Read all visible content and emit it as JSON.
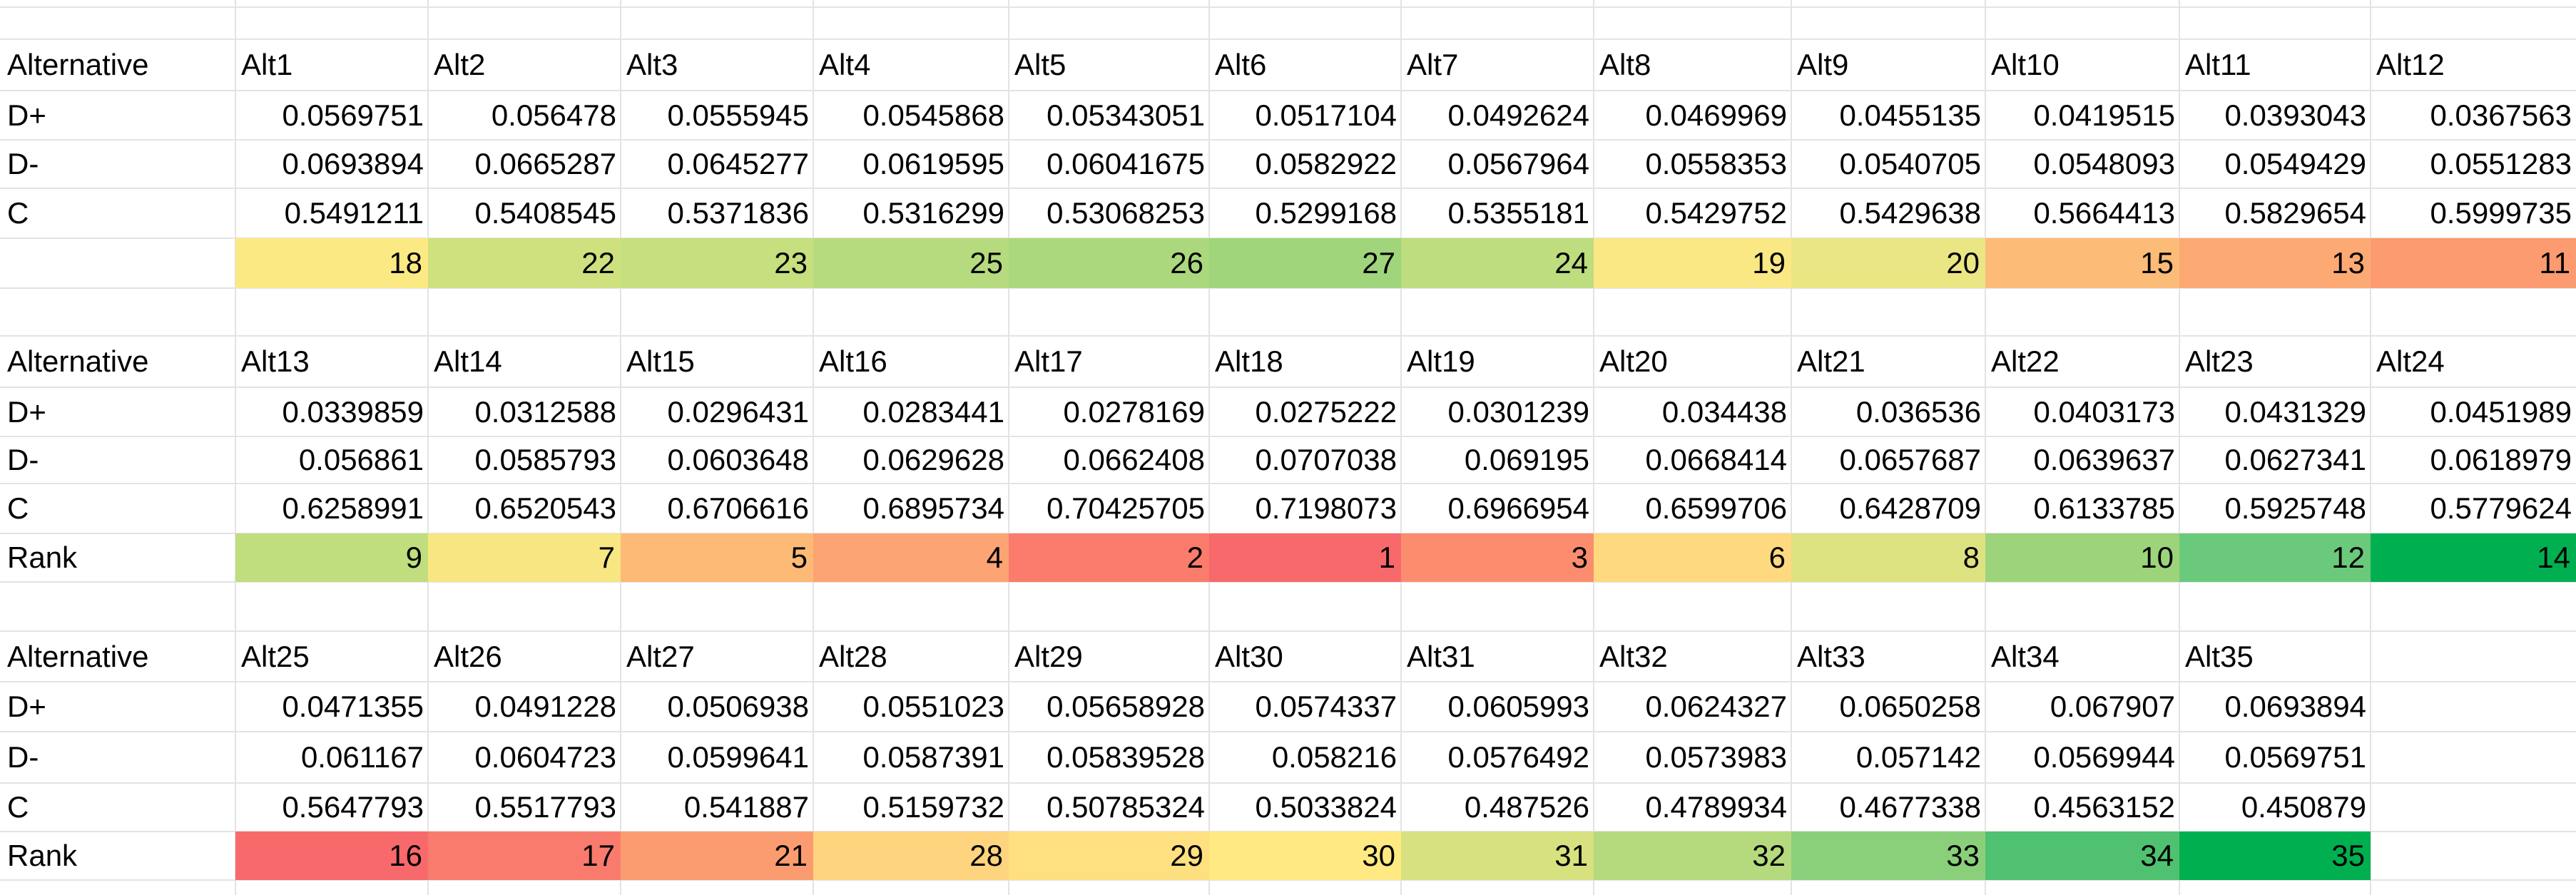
{
  "sheet": {
    "blocks": [
      {
        "header_label": "Alternative",
        "alternatives": [
          "Alt1",
          "Alt2",
          "Alt3",
          "Alt4",
          "Alt5",
          "Alt6",
          "Alt7",
          "Alt8",
          "Alt9",
          "Alt10",
          "Alt11",
          "Alt12"
        ],
        "rows": [
          {
            "label": "D+",
            "values": [
              "0.0569751",
              "0.056478",
              "0.0555945",
              "0.0545868",
              "0.05343051",
              "0.0517104",
              "0.0492624",
              "0.0469969",
              "0.0455135",
              "0.0419515",
              "0.0393043",
              "0.0367563"
            ]
          },
          {
            "label": "D-",
            "values": [
              "0.0693894",
              "0.0665287",
              "0.0645277",
              "0.0619595",
              "0.06041675",
              "0.0582922",
              "0.0567964",
              "0.0558353",
              "0.0540705",
              "0.0548093",
              "0.0549429",
              "0.0551283"
            ]
          },
          {
            "label": "C",
            "values": [
              "0.5491211",
              "0.5408545",
              "0.5371836",
              "0.5316299",
              "0.53068253",
              "0.5299168",
              "0.5355181",
              "0.5429752",
              "0.5429638",
              "0.5664413",
              "0.5829654",
              "0.5999735"
            ]
          }
        ],
        "rank_label": "",
        "ranks": [
          "18",
          "22",
          "23",
          "25",
          "26",
          "27",
          "24",
          "19",
          "20",
          "15",
          "13",
          "11"
        ],
        "rank_colors": [
          "#fbe983",
          "#cfe17f",
          "#c6df7f",
          "#b6db7e",
          "#abd87d",
          "#a0d57c",
          "#bddd7e",
          "#f9e883",
          "#eae683",
          "#fdbb78",
          "#fda974",
          "#fc9a70"
        ]
      },
      {
        "header_label": "Alternative",
        "alternatives": [
          "Alt13",
          "Alt14",
          "Alt15",
          "Alt16",
          "Alt17",
          "Alt18",
          "Alt19",
          "Alt20",
          "Alt21",
          "Alt22",
          "Alt23",
          "Alt24"
        ],
        "rows": [
          {
            "label": "D+",
            "values": [
              "0.0339859",
              "0.0312588",
              "0.0296431",
              "0.0283441",
              "0.0278169",
              "0.0275222",
              "0.0301239",
              "0.034438",
              "0.036536",
              "0.0403173",
              "0.0431329",
              "0.0451989"
            ]
          },
          {
            "label": "D-",
            "values": [
              "0.056861",
              "0.0585793",
              "0.0603648",
              "0.0629628",
              "0.0662408",
              "0.0707038",
              "0.069195",
              "0.0668414",
              "0.0657687",
              "0.0639637",
              "0.0627341",
              "0.0618979"
            ]
          },
          {
            "label": "C",
            "values": [
              "0.6258991",
              "0.6520543",
              "0.6706616",
              "0.6895734",
              "0.70425705",
              "0.7198073",
              "0.6966954",
              "0.6599706",
              "0.6428709",
              "0.6133785",
              "0.5925748",
              "0.5779624"
            ]
          }
        ],
        "rank_label": "Rank",
        "ranks": [
          "9",
          "7",
          "5",
          "4",
          "2",
          "1",
          "3",
          "6",
          "8",
          "10",
          "12",
          "14"
        ],
        "rank_colors": [
          "#c1de7f",
          "#f7e682",
          "#fdba77",
          "#fca473",
          "#fb7b6c",
          "#f8696b",
          "#fb8d6e",
          "#fed980",
          "#dde281",
          "#9dd47b",
          "#6bc97b",
          "#00b050"
        ]
      },
      {
        "header_label": "Alternative",
        "alternatives": [
          "Alt25",
          "Alt26",
          "Alt27",
          "Alt28",
          "Alt29",
          "Alt30",
          "Alt31",
          "Alt32",
          "Alt33",
          "Alt34",
          "Alt35"
        ],
        "rows": [
          {
            "label": "D+",
            "values": [
              "0.0471355",
              "0.0491228",
              "0.0506938",
              "0.0551023",
              "0.05658928",
              "0.0574337",
              "0.0605993",
              "0.0624327",
              "0.0650258",
              "0.067907",
              "0.0693894"
            ]
          },
          {
            "label": "D-",
            "values": [
              "0.061167",
              "0.0604723",
              "0.0599641",
              "0.0587391",
              "0.05839528",
              "0.058216",
              "0.0576492",
              "0.0573983",
              "0.057142",
              "0.0569944",
              "0.0569751"
            ]
          },
          {
            "label": "C",
            "values": [
              "0.5647793",
              "0.5517793",
              "0.541887",
              "0.5159732",
              "0.50785324",
              "0.5033824",
              "0.487526",
              "0.4789934",
              "0.4677338",
              "0.4563152",
              "0.450879"
            ]
          }
        ],
        "rank_label": "Rank",
        "ranks": [
          "16",
          "17",
          "21",
          "28",
          "29",
          "30",
          "31",
          "32",
          "33",
          "34",
          "35"
        ],
        "rank_colors": [
          "#f8696b",
          "#f97b6d",
          "#fb9c70",
          "#fed47f",
          "#fee081",
          "#fee982",
          "#d7e17f",
          "#b4da7d",
          "#8ad07b",
          "#4fc170",
          "#00b050"
        ]
      }
    ]
  }
}
